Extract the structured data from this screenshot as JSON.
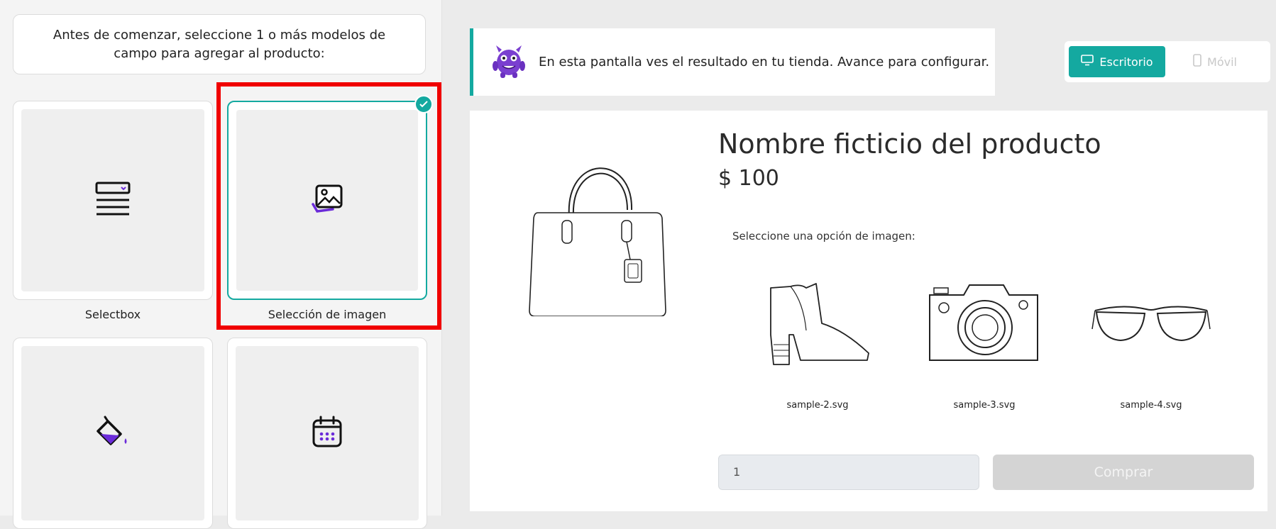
{
  "intro": {
    "text": "Antes de comenzar, seleccione 1 o más modelos de campo para agregar al producto:"
  },
  "cards": [
    {
      "label": "Selectbox",
      "icon": "selectbox-icon"
    },
    {
      "label": "Selección de imagen",
      "icon": "image-selection-icon",
      "selected": true
    },
    {
      "label": "",
      "icon": "paint-bucket-icon"
    },
    {
      "label": "",
      "icon": "calendar-icon"
    }
  ],
  "banner": {
    "text": "En esta pantalla ves el resultado en tu tienda. Avance para configurar."
  },
  "view_toggle": {
    "desktop": "Escritorio",
    "mobile": "Móvil"
  },
  "product": {
    "name": "Nombre ficticio del producto",
    "price": "$ 100",
    "option_label": "Seleccione una opción de imagen:",
    "options": [
      "sample-2.svg",
      "sample-3.svg",
      "sample-4.svg"
    ],
    "quantity": "1",
    "buy_label": "Comprar"
  },
  "colors": {
    "accent": "#14a9a0",
    "highlight": "#f00000",
    "icon_purple": "#6b2bd9"
  }
}
